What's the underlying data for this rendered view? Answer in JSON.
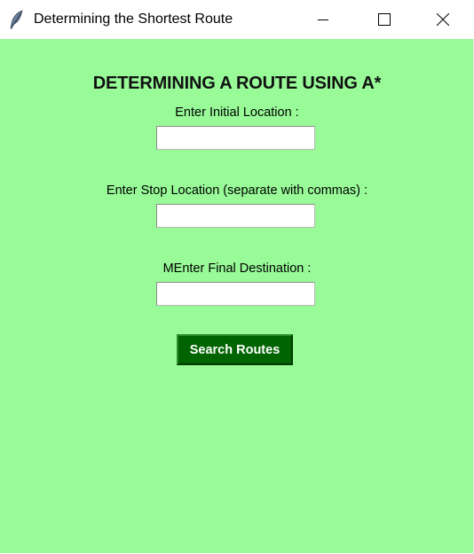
{
  "window": {
    "title": "Determining the Shortest Route",
    "icon": "feather-icon",
    "controls": [
      "minimize-icon",
      "maximize-icon",
      "close-icon"
    ]
  },
  "colors": {
    "background": "#98fb98",
    "button_bg": "#006400",
    "button_text": "#ffffff"
  },
  "form": {
    "heading": "DETERMINING A ROUTE USING A*",
    "initial_label": "Enter Initial Location :",
    "initial_value": "",
    "stop_label": "Enter Stop Location (separate with commas) :",
    "stop_value": "",
    "final_label": "MEnter Final Destination :",
    "final_value": "",
    "search_button": "Search Routes"
  }
}
